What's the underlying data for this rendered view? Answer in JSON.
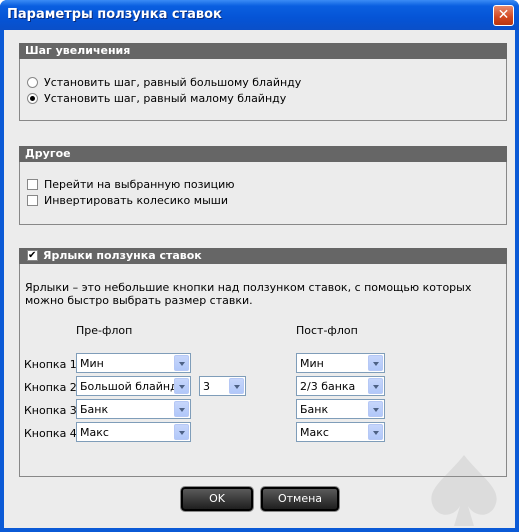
{
  "window": {
    "title": "Параметры ползунка ставок"
  },
  "sections": {
    "step": {
      "title": "Шаг увеличения",
      "options": [
        {
          "label": "Установить шаг, равный большому блайнду",
          "selected": false
        },
        {
          "label": "Установить шаг, равный малому блайнду",
          "selected": true
        }
      ]
    },
    "other": {
      "title": "Другое",
      "options": [
        {
          "label": "Перейти на выбранную позицию",
          "checked": false
        },
        {
          "label": "Инвертировать колесико мыши",
          "checked": false
        }
      ]
    },
    "labels": {
      "title": "Ярлыки ползунка ставок",
      "enabled": true,
      "description": "Ярлыки – это небольшие кнопки над ползунком ставок, с помощью которых можно быстро выбрать размер ставки.",
      "preflop_header": "Пре-флоп",
      "postflop_header": "Пост-флоп",
      "rows": [
        {
          "label": "Кнопка 1",
          "preflop": "Мин",
          "postflop": "Мин"
        },
        {
          "label": "Кнопка 2",
          "preflop": "Большой блайнд",
          "multiplier": "3",
          "postflop": "2/3 банка"
        },
        {
          "label": "Кнопка 3",
          "preflop": "Банк",
          "postflop": "Банк"
        },
        {
          "label": "Кнопка 4",
          "preflop": "Макс",
          "postflop": "Макс"
        }
      ]
    }
  },
  "buttons": {
    "ok": "OK",
    "cancel": "Отмена"
  },
  "colors": {
    "titlebar": "#0554d6",
    "section_header": "#666666",
    "client_bg": "#ececec"
  }
}
